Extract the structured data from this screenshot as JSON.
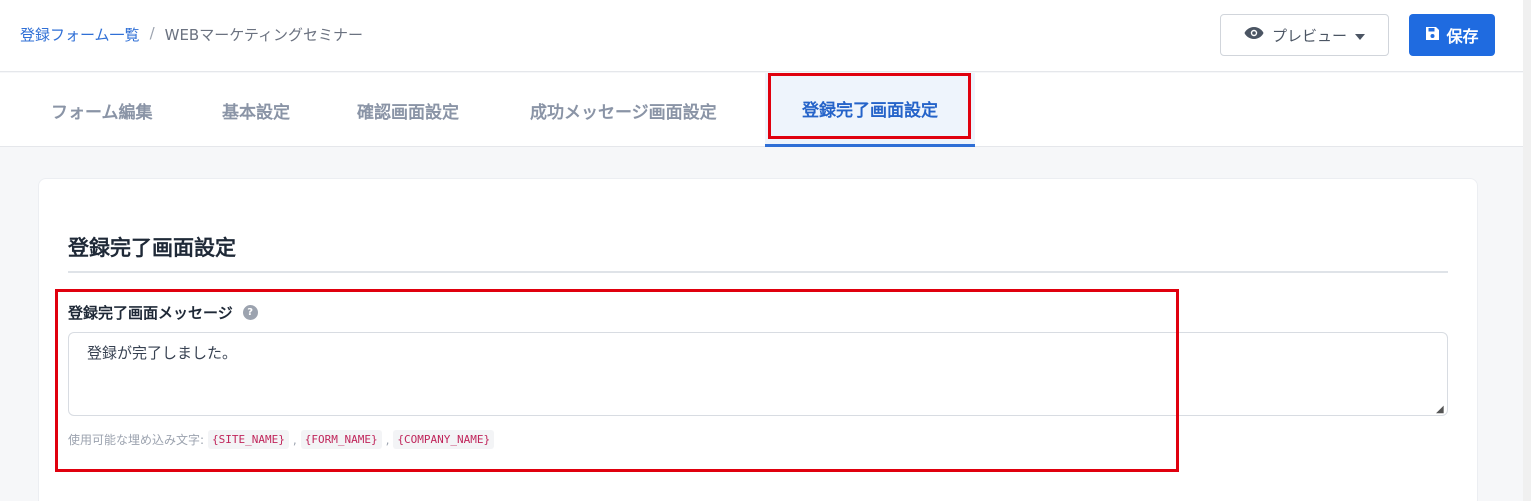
{
  "breadcrumb": {
    "parent": "登録フォーム一覧",
    "separator": "/",
    "current": "WEBマーケティングセミナー"
  },
  "header": {
    "preview_label": "プレビュー",
    "save_label": "保存"
  },
  "tabs": [
    {
      "label": "フォーム編集",
      "active": false
    },
    {
      "label": "基本設定",
      "active": false
    },
    {
      "label": "確認画面設定",
      "active": false
    },
    {
      "label": "成功メッセージ画面設定",
      "active": false
    },
    {
      "label": "登録完了画面設定",
      "active": true
    }
  ],
  "section": {
    "title": "登録完了画面設定",
    "field_label": "登録完了画面メッセージ",
    "help_icon": "?",
    "message_value": "登録が完了しました。",
    "hint_prefix": "使用可能な埋め込み文字:",
    "variables": [
      "{SITE_NAME}",
      "{FORM_NAME}",
      "{COMPANY_NAME}"
    ],
    "variable_separator": ","
  },
  "colors": {
    "accent": "#1f6be0",
    "highlight": "#e0000e"
  }
}
